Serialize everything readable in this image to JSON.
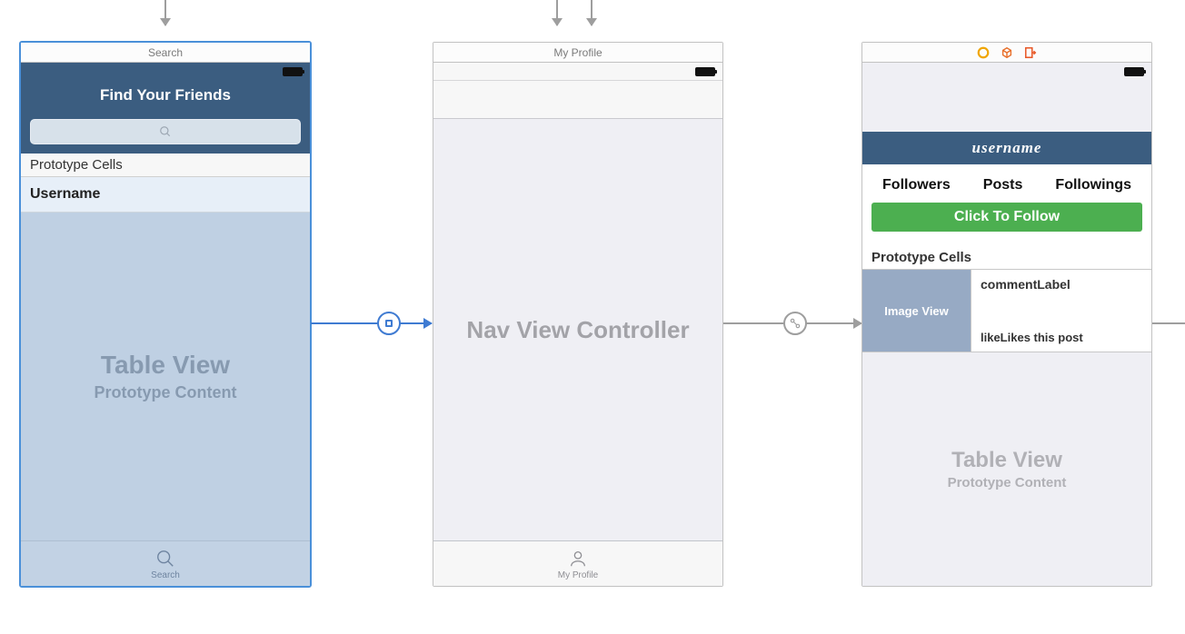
{
  "scene1": {
    "title": "Search",
    "nav_title": "Find Your Friends",
    "proto_label": "Prototype Cells",
    "cell_text": "Username",
    "table_big": "Table View",
    "table_sub": "Prototype Content",
    "tab_label": "Search"
  },
  "scene2": {
    "title": "My Profile",
    "nav_fill": "Nav View Controller",
    "tab_label": "My Profile"
  },
  "scene3": {
    "nav_title": "username",
    "stats": {
      "followers": "Followers",
      "posts": "Posts",
      "followings": "Followings"
    },
    "follow_btn": "Click To Follow",
    "proto_label": "Prototype Cells",
    "imgview": "Image View",
    "comment": "commentLabel",
    "likes1": "likeL",
    "likes2": "ikes this post",
    "table_big": "Table View",
    "table_sub": "Prototype Content"
  }
}
